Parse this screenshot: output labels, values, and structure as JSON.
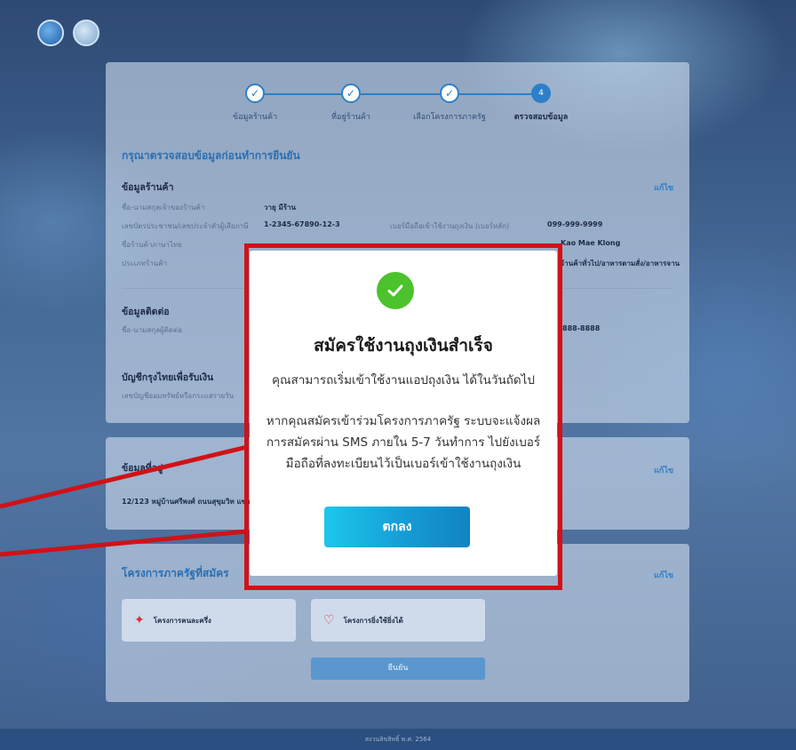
{
  "colors": {
    "accent": "#2d7fc8",
    "success": "#4cc22c",
    "annotation_red": "#d01218",
    "ok_button_start": "#1cc7ec",
    "ok_button_end": "#1183c2"
  },
  "stepper": {
    "steps": [
      {
        "label": "ข้อมูลร้านค้า",
        "state": "done"
      },
      {
        "label": "ที่อยู่ร้านค้า",
        "state": "done"
      },
      {
        "label": "เลือกโครงการภาครัฐ",
        "state": "done"
      },
      {
        "label": "ตรวจสอบข้อมูล",
        "state": "active",
        "number": "4"
      }
    ]
  },
  "review": {
    "heading": "กรุณาตรวจสอบข้อมูลก่อนทำการยืนยัน",
    "edit_label": "แก้ไข",
    "shop_info": {
      "title": "ข้อมูลร้านค้า",
      "rows": [
        {
          "label": "ชื่อ-นามสกุลเจ้าของร้านค้า",
          "value": "วายุ มีร้าน"
        },
        {
          "label": "เลขบัตรประชาชน/เลขประจำตัวผู้เสียภาษี",
          "value": "1-2345-67890-12-3"
        },
        {
          "label": "ชื่อร้านค้าภาษาไทย",
          "value": ""
        },
        {
          "label": "ประเภทร้านค้า",
          "value": ""
        }
      ],
      "right_rows": [
        {
          "label": "เบอร์มือถือเข้าใช้งานถุงเงิน (เบอร์หลัก)",
          "value": "099-999-9999"
        },
        {
          "label": "",
          "value": "Kao Mae Klong"
        },
        {
          "label": "",
          "value": "ร้านค้าทั่วไป/อาหารตามสั่ง/อาหารจาน"
        }
      ]
    },
    "contact": {
      "title": "ข้อมูลติดต่อ",
      "row_label": "ชื่อ-นามสกุลผู้ติดต่อ",
      "phone": "888-8888"
    },
    "bank": {
      "title": "บัญชีกรุงไทยเพื่อรับเงิน",
      "row_label": "เลขบัญชีออมทรัพย์หรือกระแสรายวัน"
    },
    "address": {
      "title": "ข้อมูลที่อยู่",
      "value": "12/123 หมู่บ้านศรีพงศ์ ถนนสุขุมวิท แขวงค"
    },
    "programs": {
      "title": "โครงการภาครัฐที่สมัคร",
      "items": [
        {
          "label": "โครงการคนละครึ่ง",
          "icon": "half-half-logo-icon"
        },
        {
          "label": "โครงการยิ่งใช้ยิ่งได้",
          "icon": "heart-logo-icon"
        }
      ],
      "confirm_label": "ยืนยัน"
    }
  },
  "footer": {
    "text": "สงวนลิขสิทธิ์ พ.ศ. 2564"
  },
  "modal": {
    "icon": "check-circle-icon",
    "title": "สมัครใช้งานถุงเงินสำเร็จ",
    "line1": "คุณสามารถเริ่มเข้าใช้งานแอปถุงเงิน ได้ในวันถัดไป",
    "msg_line1": "หากคุณสมัครเข้าร่วมโครงการภาครัฐ ระบบจะแจ้งผล",
    "msg_line2": "การสมัครผ่าน SMS ภายใน 5-7 วันทำการ ไปยังเบอร์",
    "msg_line3": "มือถือที่ลงทะเบียนไว้เป็นเบอร์เข้าใช้งานถุงเงิน",
    "ok_label": "ตกลง"
  }
}
